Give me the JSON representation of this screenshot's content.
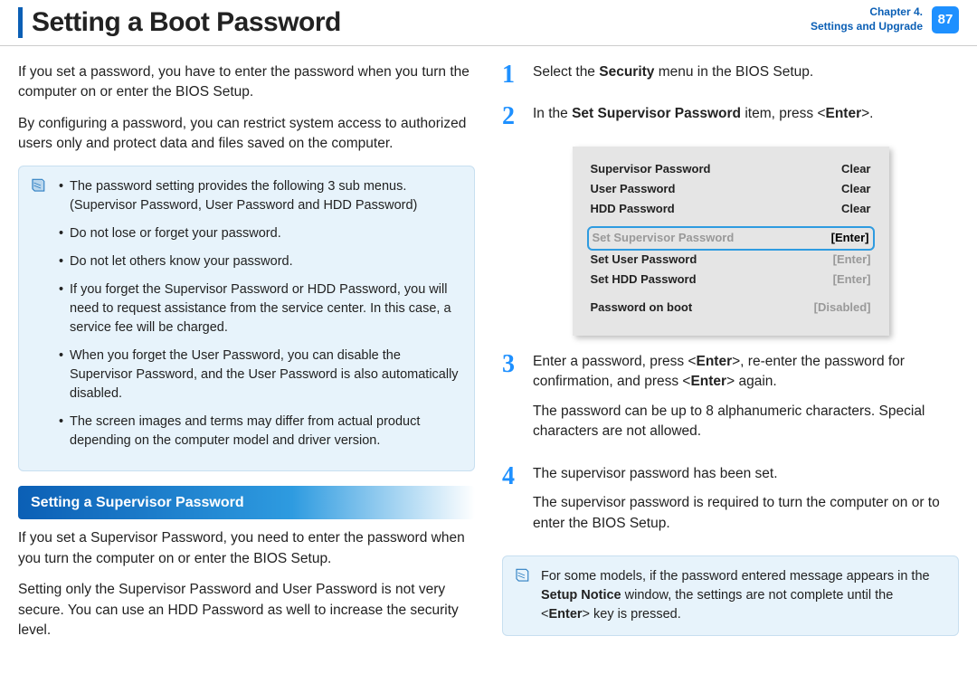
{
  "header": {
    "title": "Setting a Boot Password",
    "chapter_line1": "Chapter 4.",
    "chapter_line2": "Settings and Upgrade",
    "page": "87"
  },
  "left": {
    "p1": "If you set a password, you have to enter the password when you turn the computer on or enter the BIOS Setup.",
    "p2": "By configuring a password, you can restrict system access to authorized users only and protect data and files saved on the computer.",
    "note_items": [
      "The password setting provides the following 3 sub menus. (Supervisor Password, User Password and HDD Password)",
      "Do not lose or forget your password.",
      "Do not let others know your password.",
      "If you forget the Supervisor Password or HDD Password, you will need to request assistance from the service center. In this case, a service fee will be charged.",
      "When you forget the User Password, you can disable the Supervisor Password, and the User Password is also automatically disabled.",
      "The screen images and terms may differ from actual product depending on the computer model and driver version."
    ],
    "section_header": "Setting a Supervisor Password",
    "p3": "If you set a Supervisor Password, you need to enter the password when you turn the computer on or enter the BIOS Setup.",
    "p4": "Setting only the Supervisor Password and User Password is not very secure. You can use an HDD Password as well to increase the security level."
  },
  "right": {
    "step1_pre": "Select the ",
    "step1_bold": "Security",
    "step1_post": " menu in the BIOS Setup.",
    "step2_pre": "In the ",
    "step2_bold": "Set Supervisor Password",
    "step2_mid": " item, press <",
    "step2_bold2": "Enter",
    "step2_post": ">.",
    "bios": {
      "rows_status": [
        {
          "label": "Supervisor Password",
          "value": "Clear"
        },
        {
          "label": "User Password",
          "value": "Clear"
        },
        {
          "label": "HDD Password",
          "value": "Clear"
        }
      ],
      "rows_set": [
        {
          "label": "Set Supervisor Password",
          "value": "[Enter]",
          "hl": true,
          "muted_label": true,
          "muted_value": false
        },
        {
          "label": "Set User Password",
          "value": "[Enter]",
          "hl": false,
          "muted_label": false,
          "muted_value": true
        },
        {
          "label": "Set HDD Password",
          "value": "[Enter]",
          "hl": false,
          "muted_label": false,
          "muted_value": true
        }
      ],
      "boot_label": "Password on boot",
      "boot_value": "[Disabled]"
    },
    "step3_a_pre": "Enter a password, press <",
    "step3_a_b1": "Enter",
    "step3_a_mid": ">, re-enter the password for confirmation, and press <",
    "step3_a_b2": "Enter",
    "step3_a_post": "> again.",
    "step3_b": "The password can be up to 8 alphanumeric characters. Special characters are not allowed.",
    "step4_a": "The supervisor password has been set.",
    "step4_b": "The supervisor password is required to turn the computer on or to enter the BIOS Setup.",
    "note2_pre": "For some models, if the password entered message appears in the ",
    "note2_bold": "Setup Notice",
    "note2_mid": " window, the settings are not complete until the <",
    "note2_bold2": "Enter",
    "note2_post": "> key is pressed."
  }
}
